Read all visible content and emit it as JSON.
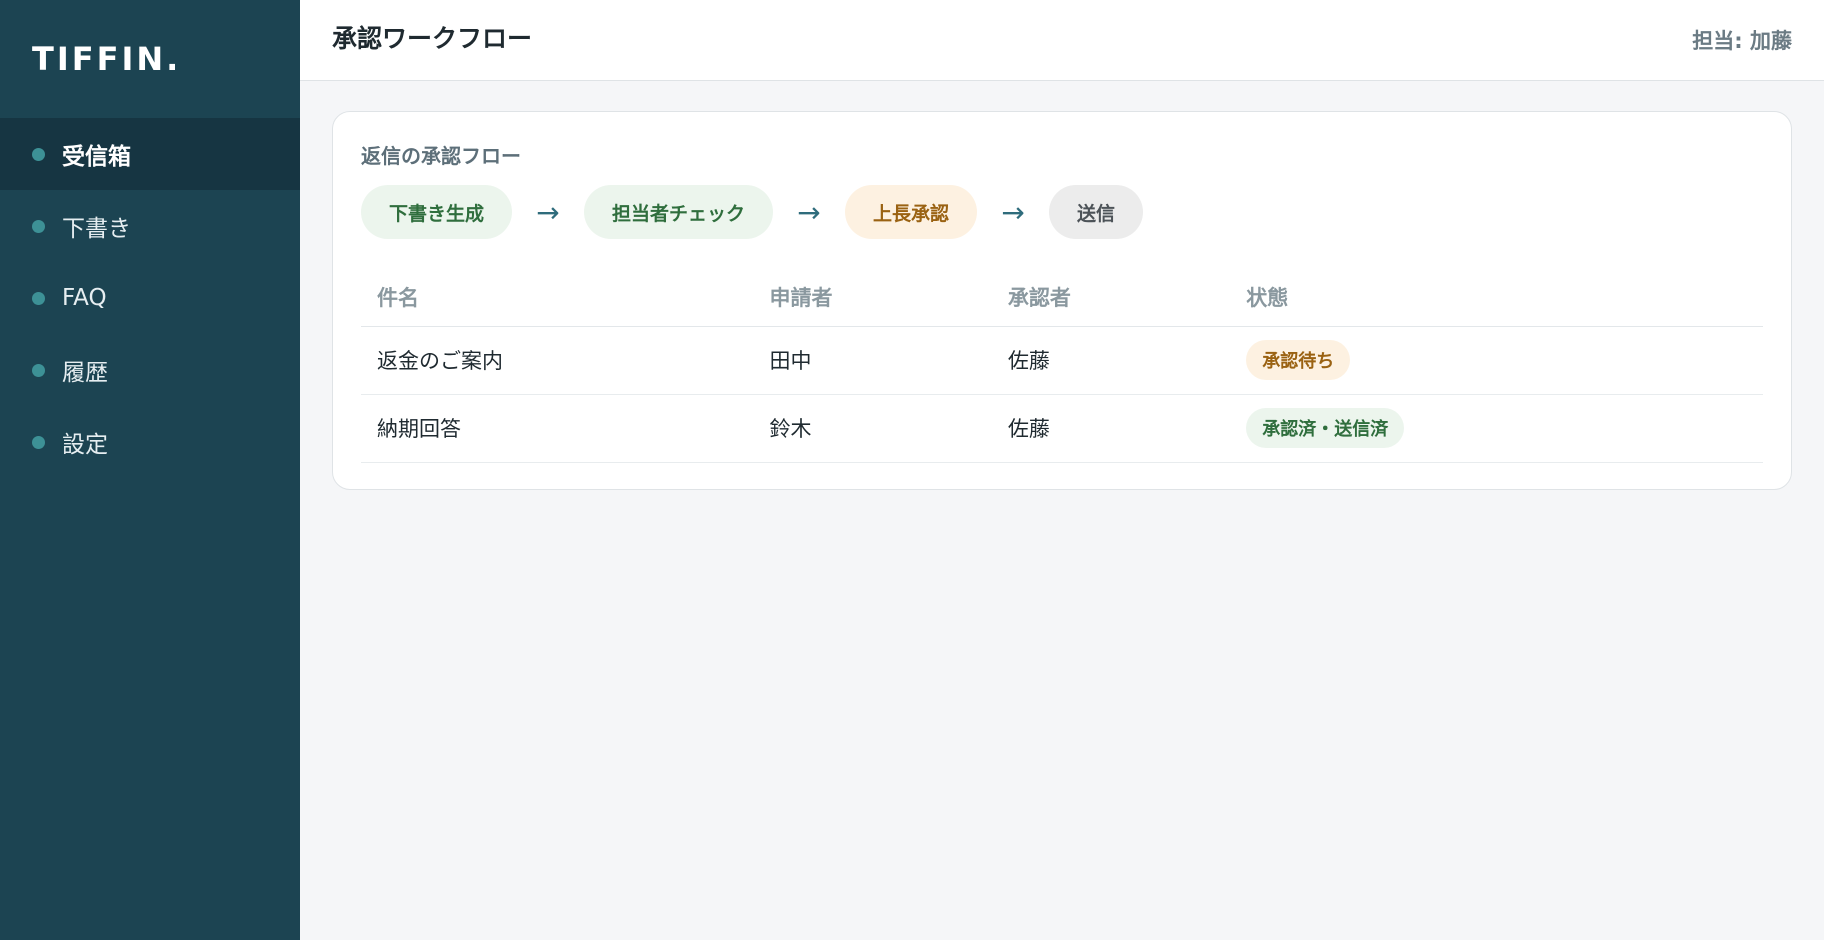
{
  "sidebar": {
    "logo": "TIFFIN.",
    "items": [
      {
        "label": "受信箱"
      },
      {
        "label": "下書き"
      },
      {
        "label": "FAQ"
      },
      {
        "label": "履歴"
      },
      {
        "label": "設定"
      }
    ]
  },
  "header": {
    "title": "承認ワークフロー",
    "assignee": "担当: 加藤"
  },
  "flow_card": {
    "title": "返信の承認フロー",
    "steps": [
      {
        "label": "下書き生成"
      },
      {
        "label": "担当者チェック"
      },
      {
        "label": "上長承認"
      },
      {
        "label": "送信"
      }
    ],
    "arrow": "→"
  },
  "table": {
    "headers": [
      "件名",
      "申請者",
      "承認者",
      "状態"
    ],
    "rows": [
      {
        "subject": "返金のご案内",
        "requester": "田中",
        "approver": "佐藤",
        "status": "承認待ち"
      },
      {
        "subject": "納期回答",
        "requester": "鈴木",
        "approver": "佐藤",
        "status": "承認済・送信済"
      }
    ]
  },
  "colors": {
    "sidebar_bg": "#1c4452",
    "accent_green": "#2f6e3d",
    "accent_orange": "#9a6212"
  }
}
